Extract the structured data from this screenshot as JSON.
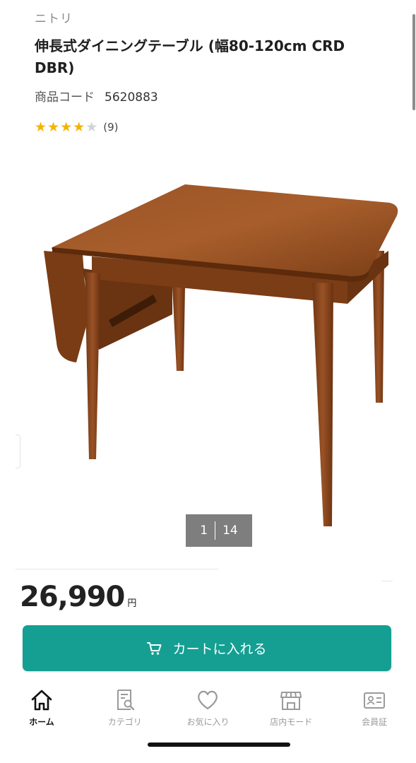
{
  "product": {
    "brand": "ニトリ",
    "title": "伸長式ダイニングテーブル (幅80-120cm CRD DBR)",
    "code_label": "商品コード",
    "code": "5620883",
    "rating": {
      "value": 4,
      "max": 5,
      "count_text": "(9)"
    },
    "image_alt": "dining table photo",
    "gallery": {
      "current": "1",
      "total": "14"
    },
    "price": "26,990",
    "currency": "円"
  },
  "cart": {
    "label": "カートに入れる",
    "icon": "cart-icon"
  },
  "tabbar": {
    "items": [
      {
        "label": "ホーム",
        "icon": "home-icon",
        "active": true
      },
      {
        "label": "カテゴリ",
        "icon": "category-search-icon",
        "active": false
      },
      {
        "label": "お気に入り",
        "icon": "heart-icon",
        "active": false
      },
      {
        "label": "店内モード",
        "icon": "store-icon",
        "active": false
      },
      {
        "label": "会員証",
        "icon": "member-card-icon",
        "active": false
      }
    ]
  },
  "colors": {
    "accent": "#159f93",
    "star": "#f5b301",
    "wood": "#8b4a1f"
  }
}
